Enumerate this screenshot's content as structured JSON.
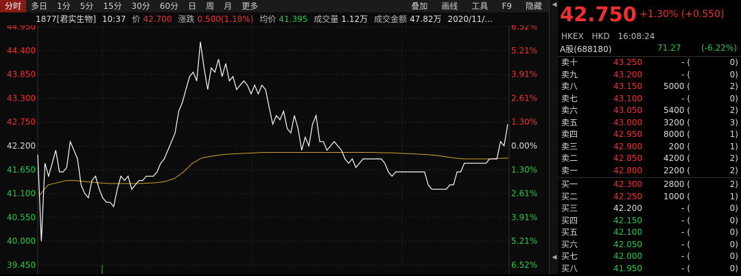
{
  "toolbar": {
    "tabs": [
      "分时",
      "多日",
      "1分",
      "5分",
      "15分",
      "30分",
      "60分",
      "日",
      "周",
      "月",
      "更多"
    ],
    "right_tabs": [
      "叠加",
      "画线",
      "工具",
      "F9",
      "隐藏"
    ]
  },
  "info": {
    "code": "1877[君实生物]",
    "time": "10:37",
    "price_label": "价",
    "price": "42.700",
    "change_label": "涨跌",
    "change": "0.500(1.18%)",
    "avg_label": "均价",
    "avg": "41.395",
    "vol_label": "成交量",
    "vol": "1.12万",
    "amount_label": "成交金额",
    "amount": "47.82万",
    "date": "2020/11/..."
  },
  "axis": {
    "left": [
      "44.950",
      "44.400",
      "43.850",
      "43.300",
      "42.750",
      "42.200",
      "41.650",
      "41.100",
      "40.550",
      "40.000",
      "39.450"
    ],
    "right": [
      "6.52%",
      "5.21%",
      "3.91%",
      "2.61%",
      "1.30%",
      "0.00%",
      "1.30%",
      "2.61%",
      "3.91%",
      "5.21%",
      "6.52%"
    ]
  },
  "chart_data": {
    "type": "line",
    "title": "",
    "ylim": [
      39.45,
      44.95
    ],
    "base": 42.2,
    "series": [
      {
        "points": [
          42.0,
          40.0,
          41.8,
          41.5,
          41.8,
          42.1,
          41.6,
          41.6,
          41.7,
          42.3,
          42.1,
          41.9,
          41.3,
          41.1,
          41.0,
          41.4,
          41.5,
          41.2,
          41.0,
          40.9,
          40.9,
          40.8,
          41.2,
          41.5,
          41.4,
          41.5,
          41.2,
          41.3,
          41.4,
          41.4,
          41.5,
          41.5,
          41.5,
          41.6,
          41.8,
          41.9,
          42.1,
          42.3,
          42.5,
          43.0,
          43.2,
          43.5,
          43.8,
          43.9,
          43.7,
          44.6,
          44.0,
          43.5,
          44.0,
          43.9,
          44.2,
          43.8,
          44.1,
          43.7,
          43.8,
          43.5,
          43.6,
          43.7,
          43.6,
          43.4,
          43.6,
          43.4,
          43.6,
          43.5,
          43.1,
          42.7,
          42.9,
          42.8,
          43.0,
          42.6,
          42.5,
          42.9,
          42.6,
          42.1,
          42.4,
          42.2,
          42.7,
          42.9,
          42.3,
          42.3,
          42.1,
          42.2,
          42.3,
          42.2,
          42.1,
          41.9,
          41.8,
          41.9,
          41.7,
          41.8,
          41.9,
          41.9,
          41.9,
          41.9,
          41.9,
          41.9,
          41.8,
          41.6,
          41.5,
          41.6,
          41.6,
          41.6,
          41.6,
          41.6,
          41.6,
          41.6,
          41.6,
          41.6,
          41.3,
          41.2,
          41.2,
          41.2,
          41.2,
          41.2,
          41.3,
          41.3,
          41.6,
          41.6,
          41.8,
          41.8,
          41.8,
          41.8,
          41.8,
          41.8,
          41.8,
          41.9,
          41.9,
          41.9,
          42.3,
          42.2,
          42.7
        ]
      },
      {
        "points": [
          41.05,
          41.3,
          41.35,
          41.4,
          41.4,
          41.38,
          41.36,
          41.34,
          41.33,
          41.33,
          41.33,
          41.33,
          41.34,
          41.35,
          41.38,
          41.45,
          41.6,
          41.8,
          41.92,
          41.96,
          41.99,
          42.01,
          42.02,
          42.03,
          42.04,
          42.05,
          42.05,
          42.05,
          42.05,
          42.05,
          42.05,
          42.05,
          42.05,
          42.05,
          42.05,
          42.05,
          42.05,
          42.05,
          42.04,
          42.04,
          42.03,
          42.02,
          42.01,
          42.0,
          41.98,
          41.95,
          41.92,
          41.9,
          41.9,
          41.9,
          41.9,
          41.91,
          41.92
        ]
      }
    ]
  },
  "quote": {
    "price": "42.750",
    "change": "+1.30%",
    "change_abs": "(+0.550)",
    "exchange": "HKEX",
    "currency": "HKD",
    "time": "16:08:24",
    "a_share_name": "A股(688180)",
    "a_share_price": "71.27",
    "a_share_change": "(-6.22%)"
  },
  "orderbook": {
    "asks": [
      {
        "name": "卖十",
        "price": "43.250",
        "vol": "-",
        "orders": "0"
      },
      {
        "name": "卖九",
        "price": "43.200",
        "vol": "-",
        "orders": "0"
      },
      {
        "name": "卖八",
        "price": "43.150",
        "vol": "5000",
        "orders": "2"
      },
      {
        "name": "卖七",
        "price": "43.100",
        "vol": "-",
        "orders": "0"
      },
      {
        "name": "卖六",
        "price": "43.050",
        "vol": "5400",
        "orders": "2"
      },
      {
        "name": "卖五",
        "price": "43.000",
        "vol": "3200",
        "orders": "3"
      },
      {
        "name": "卖四",
        "price": "42.950",
        "vol": "8000",
        "orders": "1"
      },
      {
        "name": "卖三",
        "price": "42.900",
        "vol": "200",
        "orders": "1"
      },
      {
        "name": "卖二",
        "price": "42.850",
        "vol": "4200",
        "orders": "2"
      },
      {
        "name": "卖一",
        "price": "42.800",
        "vol": "2200",
        "orders": "2"
      }
    ],
    "bids": [
      {
        "name": "买一",
        "price": "42.300",
        "vol": "2800",
        "orders": "2"
      },
      {
        "name": "买二",
        "price": "42.250",
        "vol": "1000",
        "orders": "1"
      },
      {
        "name": "买三",
        "price": "42.200",
        "vol": "-",
        "orders": "0"
      },
      {
        "name": "买四",
        "price": "42.150",
        "vol": "-",
        "orders": "0"
      },
      {
        "name": "买五",
        "price": "42.100",
        "vol": "-",
        "orders": "0"
      },
      {
        "name": "买六",
        "price": "42.050",
        "vol": "-",
        "orders": "0"
      },
      {
        "name": "买七",
        "price": "42.000",
        "vol": "-",
        "orders": "0"
      },
      {
        "name": "买八",
        "price": "41.950",
        "vol": "-",
        "orders": "0"
      }
    ]
  },
  "colors": {
    "up": "#f03030",
    "down": "#22cc44",
    "line": "#ffffff",
    "avg": "#d4a52a"
  }
}
